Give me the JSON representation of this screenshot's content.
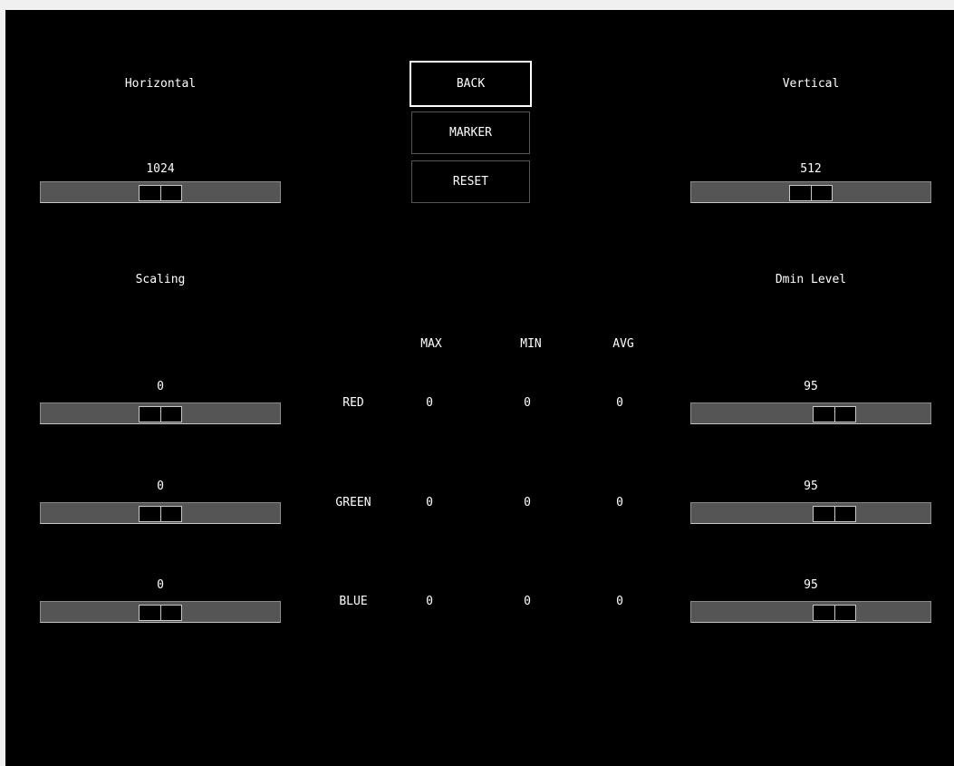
{
  "buttons": {
    "back": "BACK",
    "marker": "MARKER",
    "reset": "RESET"
  },
  "horizontal": {
    "title": "Horizontal",
    "value": "1024",
    "position_fraction": 0.5
  },
  "vertical": {
    "title": "Vertical",
    "value": "512",
    "position_fraction": 0.5
  },
  "scaling": {
    "title": "Scaling",
    "red": {
      "value": "0",
      "position_fraction": 0.5
    },
    "green": {
      "value": "0",
      "position_fraction": 0.5
    },
    "blue": {
      "value": "0",
      "position_fraction": 0.5
    }
  },
  "dmin": {
    "title": "Dmin Level",
    "red": {
      "value": "95",
      "position_fraction": 0.6
    },
    "green": {
      "value": "95",
      "position_fraction": 0.6
    },
    "blue": {
      "value": "95",
      "position_fraction": 0.6
    }
  },
  "stats": {
    "headers": [
      "MAX",
      "MIN",
      "AVG"
    ],
    "rows": [
      {
        "label": "RED",
        "max": "0",
        "min": "0",
        "avg": "0"
      },
      {
        "label": "GREEN",
        "max": "0",
        "min": "0",
        "avg": "0"
      },
      {
        "label": "BLUE",
        "max": "0",
        "min": "0",
        "avg": "0"
      }
    ]
  }
}
